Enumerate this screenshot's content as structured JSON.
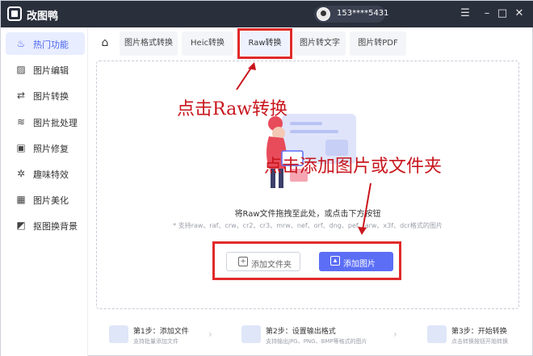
{
  "app": {
    "title": "改图鸭",
    "user_phone": "153****5431"
  },
  "window_controls": [
    "☰",
    "–",
    "□",
    "✕"
  ],
  "sidebar": {
    "items": [
      {
        "label": "热门功能",
        "icon": "flame-icon",
        "glyph": "♨",
        "active": true
      },
      {
        "label": "图片编辑",
        "icon": "image-edit-icon",
        "glyph": "▨",
        "active": false
      },
      {
        "label": "图片转换",
        "icon": "convert-icon",
        "glyph": "⇄",
        "active": false
      },
      {
        "label": "图片批处理",
        "icon": "batch-icon",
        "glyph": "≋",
        "active": false
      },
      {
        "label": "照片修复",
        "icon": "repair-icon",
        "glyph": "▣",
        "active": false
      },
      {
        "label": "趣味特效",
        "icon": "sparkle-icon",
        "glyph": "✲",
        "active": false
      },
      {
        "label": "图片美化",
        "icon": "beautify-icon",
        "glyph": "▦",
        "active": false
      },
      {
        "label": "抠图换背景",
        "icon": "cutout-icon",
        "glyph": "◩",
        "active": false
      }
    ]
  },
  "tabs": [
    {
      "label": "图片格式转换",
      "active": false
    },
    {
      "label": "Heic转换",
      "active": false
    },
    {
      "label": "Raw转换",
      "active": true
    },
    {
      "label": "图片转文字",
      "active": false
    },
    {
      "label": "图片转PDF",
      "active": false
    }
  ],
  "drop": {
    "main": "将Raw文件拖拽至此处，或点击下方按钮",
    "sub": "* 支持raw、raf、crw、cr2、cr3、mrw、nef、orf、dng、pef、arw、x3f、dcr格式的图片"
  },
  "buttons": {
    "add_folder": "添加文件夹",
    "add_image": "添加图片"
  },
  "annotations": {
    "tab_hint": "点击Raw转换",
    "button_hint": "点击添加图片或文件夹"
  },
  "steps": [
    {
      "title": "第1步：添加文件",
      "desc": "支持批量添加文件"
    },
    {
      "title": "第2步：设置输出格式",
      "desc": "支持输出JPG、PNG、BMP等格式的图片"
    },
    {
      "title": "第3步：开始转换",
      "desc": "点击转换按钮开始转换"
    }
  ],
  "colors": {
    "accent": "#5b6ef5",
    "annotation_red": "#c8161d",
    "titlebar": "#2a2f3c"
  }
}
